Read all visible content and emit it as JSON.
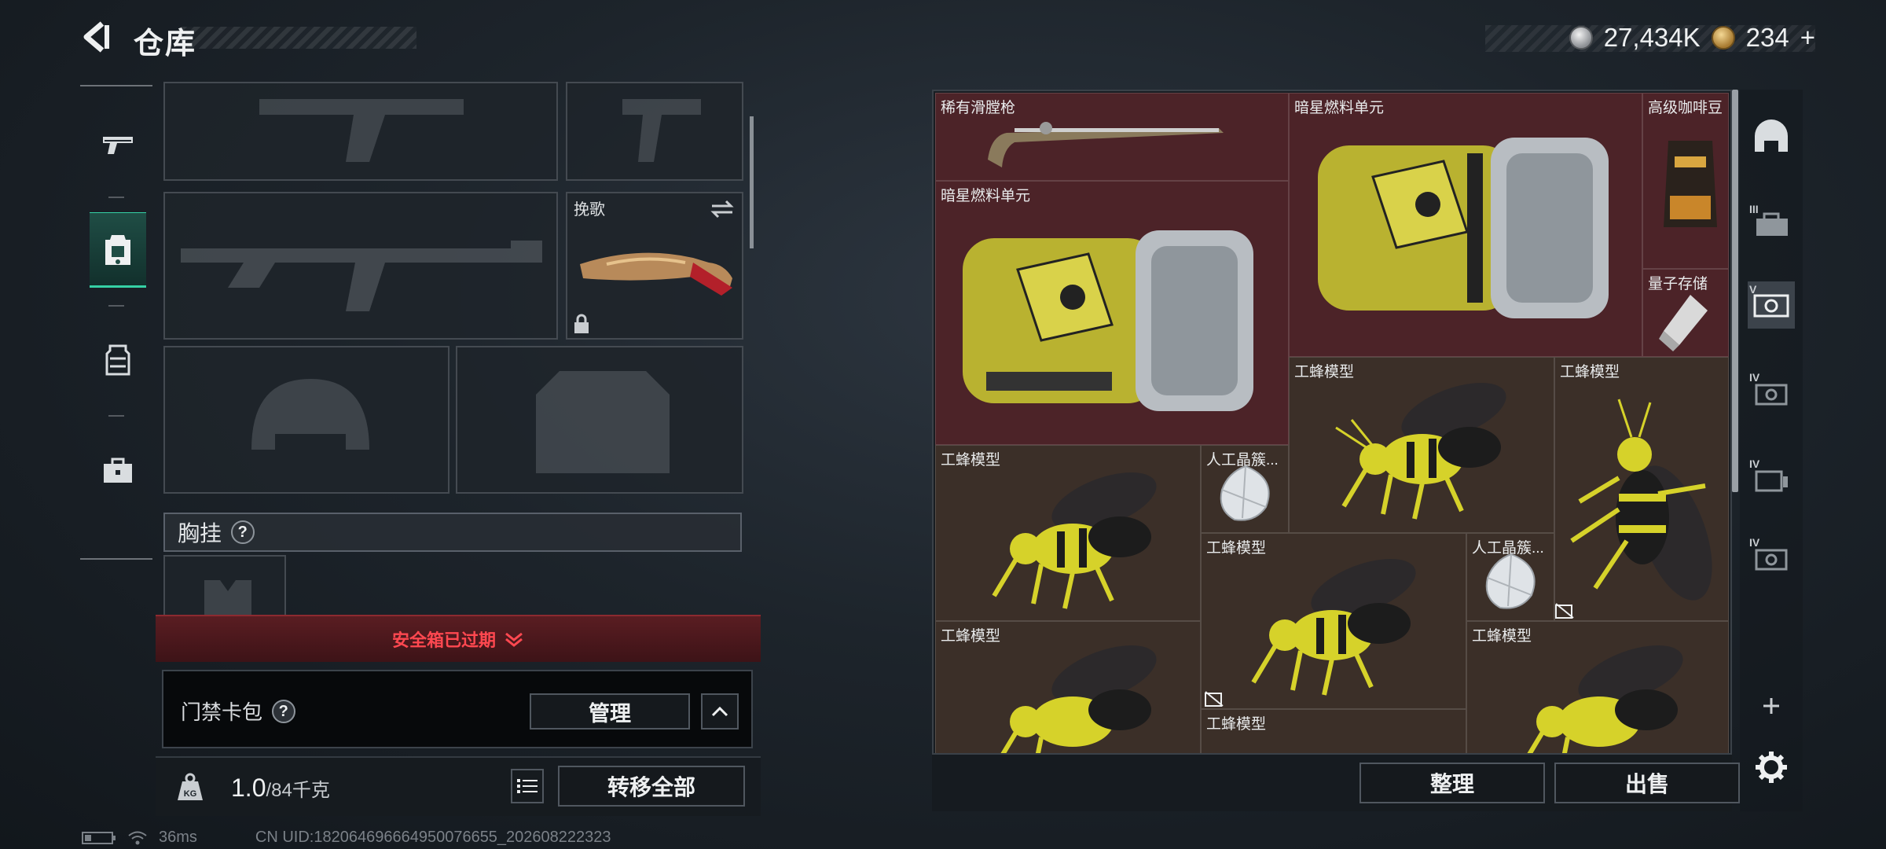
{
  "header": {
    "title": "仓库",
    "currency": [
      {
        "icon": "silver-coin-icon",
        "value": "27,434K"
      },
      {
        "icon": "gold-coin-icon",
        "value": "234",
        "suffix": "+"
      }
    ]
  },
  "left_nav": [
    "gun-icon",
    "backpack-icon",
    "vest-icon",
    "briefcase-icon"
  ],
  "equipment": {
    "melee_label": "挽歌",
    "chest_label": "胸挂",
    "chest_help": "?"
  },
  "safebox": {
    "expired_text": "安全箱已过期"
  },
  "keycard": {
    "label": "门禁卡包",
    "help": "?",
    "manage_label": "管理"
  },
  "weight": {
    "current": "1.0",
    "max": "/84千克"
  },
  "transfer_all_label": "转移全部",
  "status": {
    "ping": "36ms",
    "uid": "CN UID:18206469666495007665​5_202608222323"
  },
  "inventory": {
    "items": [
      {
        "name": "稀有滑膛枪",
        "bg": "red"
      },
      {
        "name": "暗星燃料单元",
        "bg": "red"
      },
      {
        "name": "高级咖啡豆",
        "bg": "red"
      },
      {
        "name": "暗星燃料单元",
        "bg": "red"
      },
      {
        "name": "量子存储",
        "bg": "red"
      },
      {
        "name": "工蜂模型",
        "bg": "brown"
      },
      {
        "name": "工蜂模型",
        "bg": "brown"
      },
      {
        "name": "工蜂模型",
        "bg": "brown"
      },
      {
        "name": "人工晶簇...",
        "bg": "brown"
      },
      {
        "name": "工蜂模型",
        "bg": "brown"
      },
      {
        "name": "人工晶簇...",
        "bg": "brown"
      },
      {
        "name": "工蜂模型",
        "bg": "brown"
      },
      {
        "name": "工蜂模型",
        "bg": "brown"
      },
      {
        "name": "工蜂模型",
        "bg": "brown"
      }
    ]
  },
  "actions": {
    "organize_label": "整理",
    "sell_label": "出售"
  },
  "right_nav": [
    {
      "icon": "helmet-icon",
      "tier": ""
    },
    {
      "icon": "case-icon",
      "tier": "III"
    },
    {
      "icon": "case-icon",
      "tier": "V"
    },
    {
      "icon": "case-icon",
      "tier": "IV"
    },
    {
      "icon": "case-icon",
      "tier": "IV"
    },
    {
      "icon": "case-icon",
      "tier": "IV"
    }
  ],
  "colors": {
    "accent": "#35d0a5",
    "warning": "#ff4850",
    "rare_bg": "#4c2328",
    "common_bg": "#3b2f28"
  }
}
